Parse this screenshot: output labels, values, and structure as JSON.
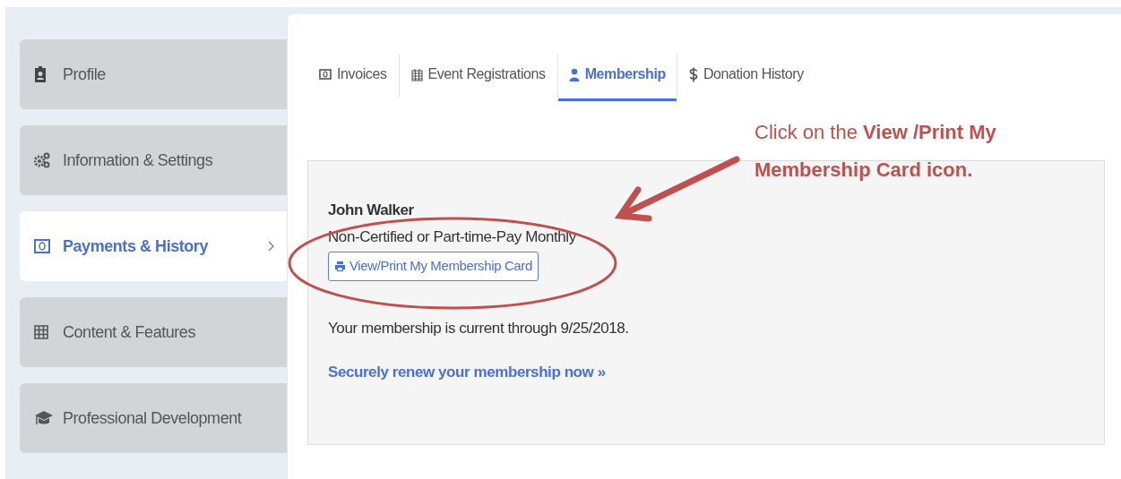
{
  "sidebar": {
    "items": [
      {
        "label": "Profile",
        "kind": "profile",
        "selected": false
      },
      {
        "label": "Information & Settings",
        "kind": "settings",
        "selected": false
      },
      {
        "label": "Payments & History",
        "kind": "payments",
        "selected": true
      },
      {
        "label": "Content & Features",
        "kind": "grid",
        "selected": false
      },
      {
        "label": "Professional Development",
        "kind": "education",
        "selected": false
      }
    ]
  },
  "tabs": [
    {
      "label": "Invoices",
      "kind": "invoice",
      "selected": false
    },
    {
      "label": "Event Registrations",
      "kind": "calendar",
      "selected": false
    },
    {
      "label": "Membership",
      "kind": "member",
      "selected": true
    },
    {
      "label": "Donation History",
      "kind": "dollar",
      "selected": false
    }
  ],
  "membership": {
    "name": "John Walker",
    "plan": "Non-Certified or Part-time-Pay Monthly",
    "card_button": "View/Print My Membership Card",
    "status": "Your membership is current through 9/25/2018.",
    "renew_link": "Securely renew your membership now »"
  },
  "annotation": {
    "text": "Click on the **View /Print My Membership Card icon.**"
  }
}
